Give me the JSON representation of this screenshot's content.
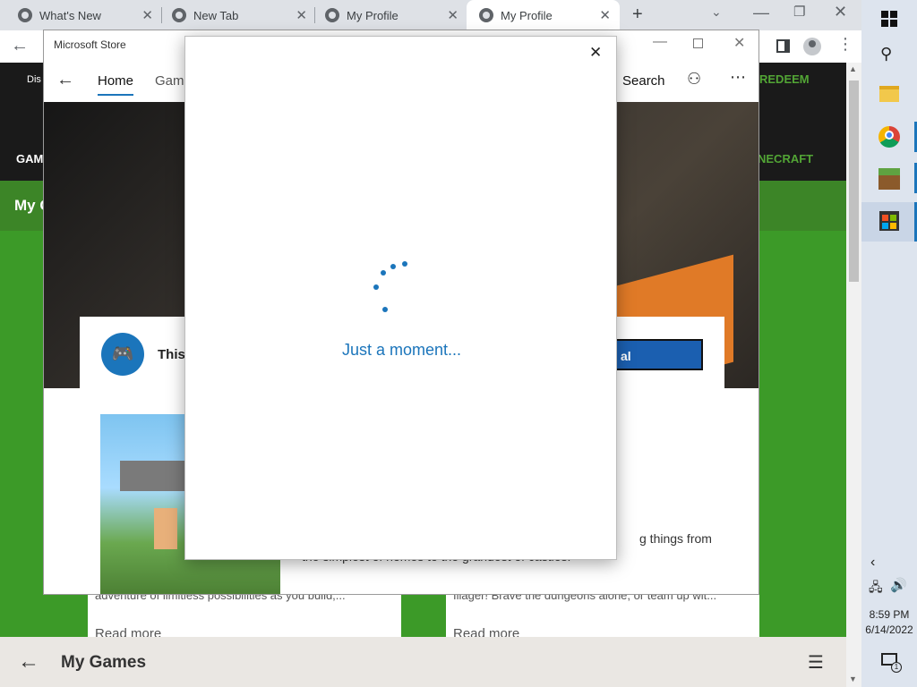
{
  "browser": {
    "tabs": [
      {
        "label": "What's New"
      },
      {
        "label": "New Tab"
      },
      {
        "label": "My Profile"
      },
      {
        "label": "My Profile",
        "active": true
      }
    ],
    "new_tab_label": "+"
  },
  "site": {
    "topnav_left": "Dis",
    "redeem_label": "REDEEM",
    "games_label": "GAM",
    "minecraft_label": "NECRAFT",
    "section_title": "My G",
    "cards": [
      {
        "desc": "adventure of limitless possibilities as you build,...",
        "read_more": "Read more"
      },
      {
        "desc": "Illager! Brave the dungeons alone, or team up wit...",
        "read_more": "Read more"
      }
    ],
    "bottom_title": "My Games"
  },
  "store": {
    "window_title": "Microsoft Store",
    "nav": {
      "home": "Home",
      "games": "Gami",
      "search": "Search"
    },
    "banner_text": "This",
    "banner_button": "al",
    "product_text_1": "g things from",
    "product_text_2": "the simplest of homes to the grandest of castles."
  },
  "dialog": {
    "loading_text": "Just a moment..."
  },
  "system": {
    "time": "8:59 PM",
    "date": "6/14/2022",
    "notification_count": "1"
  },
  "colors": {
    "accent": "#1b75bb",
    "site_green": "#3c8527",
    "minecraft_green": "#52a535"
  }
}
